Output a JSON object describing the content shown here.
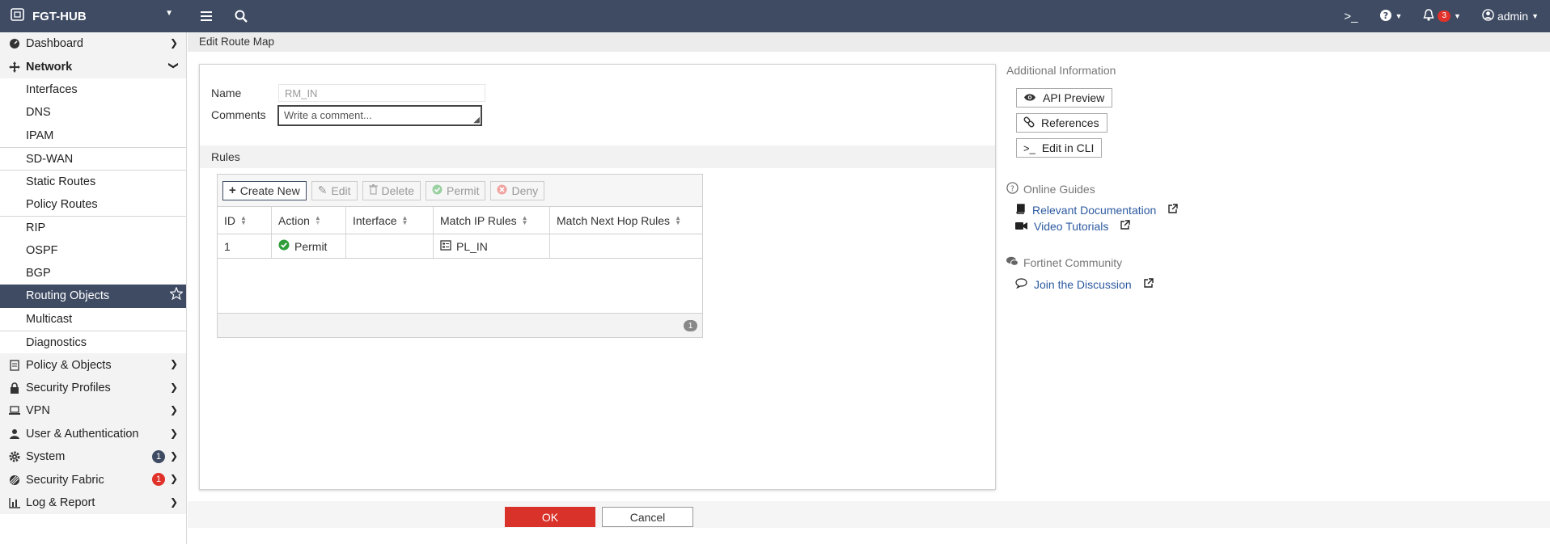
{
  "topbar": {
    "device_name": "FGT-HUB",
    "notification_count": "3",
    "user": "admin"
  },
  "sidebar": {
    "items": [
      {
        "label": "Dashboard"
      },
      {
        "label": "Network"
      },
      {
        "label": "Interfaces"
      },
      {
        "label": "DNS"
      },
      {
        "label": "IPAM"
      },
      {
        "label": "SD-WAN"
      },
      {
        "label": "Static Routes"
      },
      {
        "label": "Policy Routes"
      },
      {
        "label": "RIP"
      },
      {
        "label": "OSPF"
      },
      {
        "label": "BGP"
      },
      {
        "label": "Routing Objects"
      },
      {
        "label": "Multicast"
      },
      {
        "label": "Diagnostics"
      },
      {
        "label": "Policy & Objects"
      },
      {
        "label": "Security Profiles"
      },
      {
        "label": "VPN"
      },
      {
        "label": "User & Authentication"
      },
      {
        "label": "System",
        "badge": "1"
      },
      {
        "label": "Security Fabric",
        "badge": "1"
      },
      {
        "label": "Log & Report"
      }
    ]
  },
  "page": {
    "title": "Edit Route Map",
    "name_label": "Name",
    "name_value": "RM_IN",
    "comments_label": "Comments",
    "comments_placeholder": "Write a comment...",
    "rules_label": "Rules"
  },
  "toolbar": {
    "create_new": "Create New",
    "edit": "Edit",
    "delete": "Delete",
    "permit": "Permit",
    "deny": "Deny"
  },
  "table": {
    "columns": [
      "ID",
      "Action",
      "Interface",
      "Match IP Rules",
      "Match Next Hop Rules"
    ],
    "rows": [
      {
        "id": "1",
        "action": "Permit",
        "interface": "",
        "match_ip": "PL_IN",
        "match_next_hop": ""
      }
    ],
    "page_count": "1"
  },
  "footer": {
    "ok": "OK",
    "cancel": "Cancel"
  },
  "info": {
    "additional_title": "Additional Information",
    "api_preview": "API Preview",
    "references": "References",
    "edit_cli": "Edit in CLI",
    "online_guides": "Online Guides",
    "relevant_docs": "Relevant Documentation",
    "video_tutorials": "Video Tutorials",
    "community": "Fortinet Community",
    "join_discussion": "Join the Discussion"
  },
  "colors": {
    "topbar": "#3e4b63",
    "active_nav": "#3e4b63",
    "ok_button": "#d9322b",
    "link": "#2c5aa0",
    "permit_green": "#2e9d3a",
    "badge_red": "#e0312a"
  }
}
